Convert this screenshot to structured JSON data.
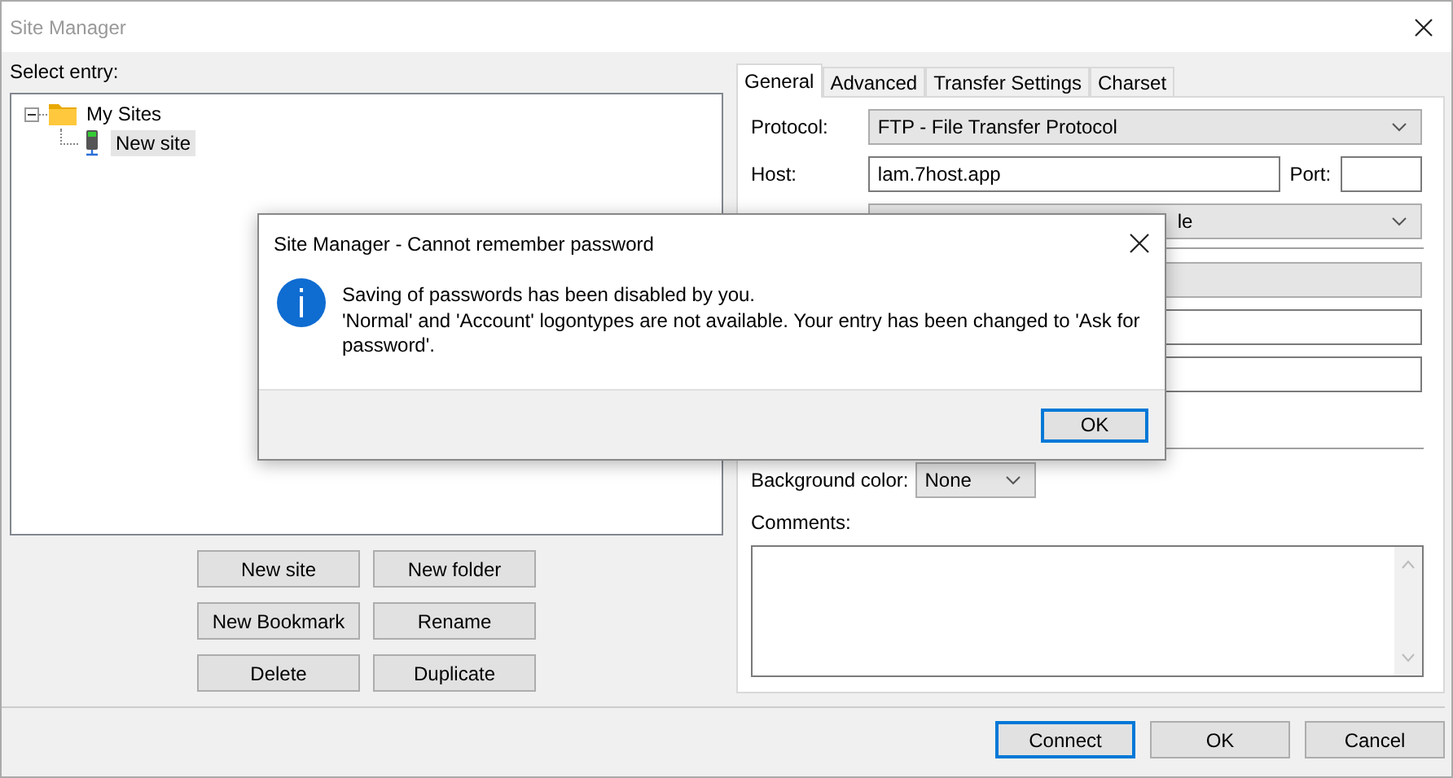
{
  "window": {
    "title": "Site Manager"
  },
  "select_label": "Select entry:",
  "tree": [
    {
      "label": "My Sites",
      "kind": "folder",
      "expanded": true,
      "selected": false,
      "children": [
        {
          "label": "New site",
          "kind": "site",
          "selected": true
        }
      ]
    }
  ],
  "tree_buttons": [
    "New site",
    "New folder",
    "New Bookmark",
    "Rename",
    "Delete",
    "Duplicate"
  ],
  "tabs": [
    {
      "label": "General",
      "selected": true
    },
    {
      "label": "Advanced",
      "selected": false
    },
    {
      "label": "Transfer Settings",
      "selected": false
    },
    {
      "label": "Charset",
      "selected": false
    }
  ],
  "general": {
    "protocol_label": "Protocol:",
    "protocol": "FTP - File Transfer Protocol",
    "host_label": "Host:",
    "host": "lam.7host.app",
    "port_label": "Port:",
    "encryption_fragment": "le",
    "background_label": "Background color:",
    "background": "None",
    "comments_label": "Comments:"
  },
  "footer_buttons": [
    {
      "label": "Connect",
      "default": true
    },
    {
      "label": "OK",
      "default": false
    },
    {
      "label": "Cancel",
      "default": false
    }
  ],
  "dialog": {
    "title": "Site Manager - Cannot remember password",
    "message": "Saving of passwords has been disabled by you.\n'Normal' and 'Account' logontypes are not available. Your entry has been changed to 'Ask for password'.",
    "button": "OK"
  }
}
